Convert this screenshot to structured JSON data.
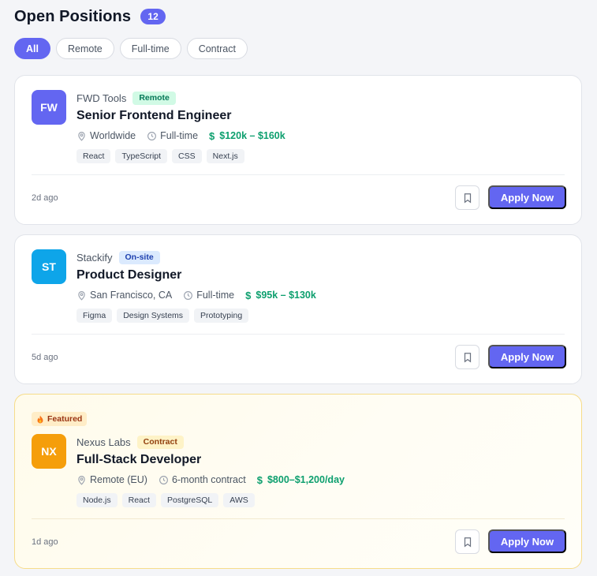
{
  "header": {
    "title": "Open Positions",
    "count": "12"
  },
  "filters": [
    {
      "label": "All",
      "active": true
    },
    {
      "label": "Remote",
      "active": false
    },
    {
      "label": "Full-time",
      "active": false
    },
    {
      "label": "Contract",
      "active": false
    }
  ],
  "colors": {
    "accent": "#6366f1",
    "salary": "#0d9f6e",
    "remote_badge_bg": "#d1fae5",
    "remote_badge_fg": "#047857",
    "onsite_badge_bg": "#dbeafe",
    "onsite_badge_fg": "#1e40af",
    "contract_badge_bg": "#fef3c7",
    "contract_badge_fg": "#92400e"
  },
  "jobs": [
    {
      "logo_text": "FW",
      "logo_color": "#6366f1",
      "company": "FWD Tools",
      "type": "Remote",
      "title": "Senior Frontend Engineer",
      "location": "Worldwide",
      "employment": "Full-time",
      "salary": "$120k – $160k",
      "tags": [
        "React",
        "TypeScript",
        "CSS",
        "Next.js"
      ],
      "posted": "2d ago",
      "apply_label": "Apply Now",
      "bookmark_icon": "bookmark-icon"
    },
    {
      "logo_text": "ST",
      "logo_color": "#0ea5e9",
      "company": "Stackify",
      "type": "On-site",
      "title": "Product Designer",
      "location": "San Francisco, CA",
      "employment": "Full-time",
      "salary": "$95k – $130k",
      "tags": [
        "Figma",
        "Design Systems",
        "Prototyping"
      ],
      "posted": "5d ago",
      "apply_label": "Apply Now",
      "bookmark_icon": "bookmark-icon"
    },
    {
      "featured_label": "Featured",
      "featured_icon": "fire-icon",
      "logo_text": "NX",
      "logo_color": "#f59e0b",
      "company": "Nexus Labs",
      "type": "Contract",
      "title": "Full-Stack Developer",
      "location": "Remote (EU)",
      "employment": "6-month contract",
      "salary": "$800–$1,200/day",
      "tags": [
        "Node.js",
        "React",
        "PostgreSQL",
        "AWS"
      ],
      "posted": "1d ago",
      "apply_label": "Apply Now",
      "bookmark_icon": "bookmark-icon"
    }
  ]
}
